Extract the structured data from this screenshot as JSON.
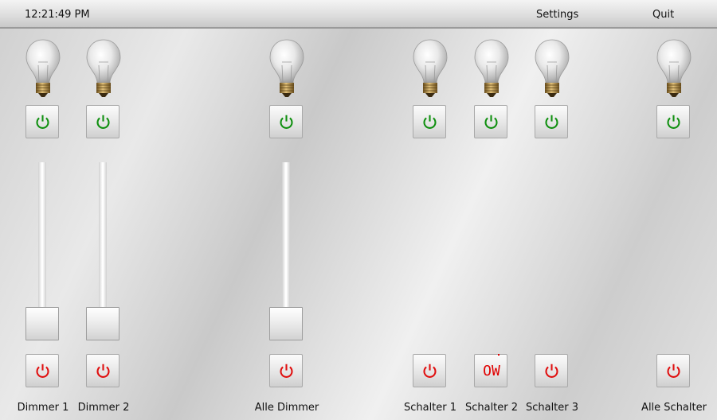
{
  "topbar": {
    "time": "12:21:49 PM",
    "settings_label": "Settings",
    "quit_label": "Quit"
  },
  "colors": {
    "on": "#109010",
    "off": "#e01010"
  },
  "icons": {
    "bulb": "lightbulb-icon",
    "power": "power-icon"
  },
  "controls": [
    {
      "name": "dimmer-1",
      "label": "Dimmer 1",
      "type": "dimmer",
      "level": 0
    },
    {
      "name": "dimmer-2",
      "label": "Dimmer 2",
      "type": "dimmer",
      "level": 0
    },
    {
      "name": "alle-dimmer",
      "label": "Alle Dimmer",
      "type": "dimmer",
      "level": 0
    },
    {
      "name": "schalter-1",
      "label": "Schalter 1",
      "type": "switch"
    },
    {
      "name": "schalter-2",
      "label": "Schalter 2",
      "type": "switch",
      "off_button_text": "OW"
    },
    {
      "name": "schalter-3",
      "label": "Schalter 3",
      "type": "switch"
    },
    {
      "name": "alle-schalter",
      "label": "Alle Schalter",
      "type": "switch"
    }
  ]
}
